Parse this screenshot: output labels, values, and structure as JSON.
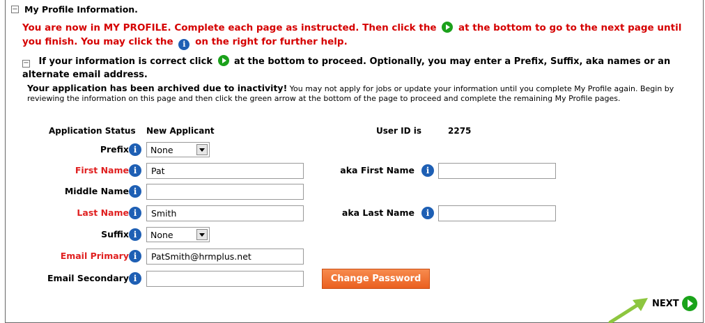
{
  "section_title": "My Profile Information.",
  "intro": {
    "part1": "You are now in MY PROFILE. Complete each page as instructed. Then click the",
    "part2": "at the bottom to go to the next page until you finish. You may click the",
    "part3": "on the right for further help."
  },
  "correct": {
    "part1": "If your information is correct click",
    "part2": "at the bottom to proceed. Optionally, you may enter a Prefix, Suffix, aka names or an alternate email address."
  },
  "archived": {
    "bold": "Your application has been archived due to inactivity!",
    "text": "You may not apply for jobs or update your information until you complete My Profile again. Begin by reviewing the information on this page and then click the green arrow at the bottom of the page to proceed and complete the remaining My Profile pages."
  },
  "status": {
    "label": "Application Status",
    "value": "New Applicant",
    "userid_label": "User ID is",
    "userid_value": "2275"
  },
  "form": {
    "prefix": {
      "label": "Prefix",
      "value": "None"
    },
    "first_name": {
      "label": "First Name",
      "value": "Pat"
    },
    "middle_name": {
      "label": "Middle Name",
      "value": ""
    },
    "last_name": {
      "label": "Last Name",
      "value": "Smith"
    },
    "suffix": {
      "label": "Suffix",
      "value": "None"
    },
    "email_primary": {
      "label": "Email Primary",
      "value": "PatSmith@hrmplus.net"
    },
    "email_secondary": {
      "label": "Email Secondary",
      "value": ""
    },
    "aka_first": {
      "label": "aka First Name",
      "value": ""
    },
    "aka_last": {
      "label": "aka Last Name",
      "value": ""
    }
  },
  "buttons": {
    "change_password": "Change Password",
    "next": "NEXT"
  },
  "colors": {
    "required_label": "#e02020",
    "intro_text": "#d50000",
    "info_icon": "#1e5fb4",
    "play_icon": "#1aa31a",
    "button_orange": "#ea6020",
    "annotation_arrow": "#8dc63f"
  },
  "icons": {
    "info": "i"
  }
}
